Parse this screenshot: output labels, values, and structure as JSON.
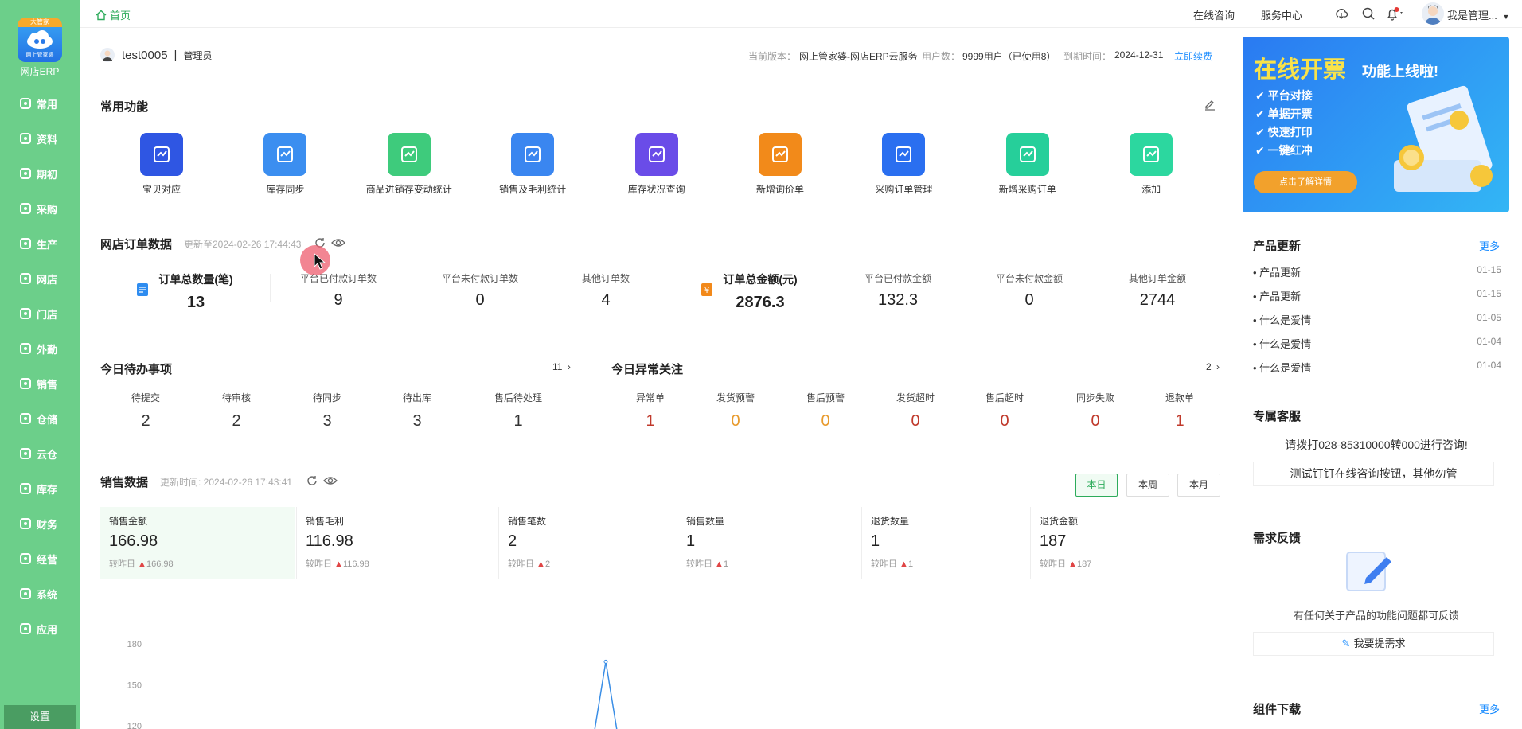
{
  "sidebar": {
    "logo_ribbon": "大管家",
    "logo_sub": "网上管家婆",
    "app_name": "网店ERP",
    "items": [
      {
        "label": "常用",
        "icon": "star-icon"
      },
      {
        "label": "资料",
        "icon": "document-icon"
      },
      {
        "label": "期初",
        "icon": "clock-icon"
      },
      {
        "label": "采购",
        "icon": "cart-icon"
      },
      {
        "label": "生产",
        "icon": "factory-icon"
      },
      {
        "label": "网店",
        "icon": "store-icon"
      },
      {
        "label": "门店",
        "icon": "shop-icon"
      },
      {
        "label": "外勤",
        "icon": "location-icon"
      },
      {
        "label": "销售",
        "icon": "sales-icon"
      },
      {
        "label": "仓储",
        "icon": "warehouse-icon"
      },
      {
        "label": "云仓",
        "icon": "cloud-warehouse-icon"
      },
      {
        "label": "库存",
        "icon": "inventory-icon"
      },
      {
        "label": "财务",
        "icon": "finance-icon"
      },
      {
        "label": "经营",
        "icon": "business-icon"
      },
      {
        "label": "系统",
        "icon": "gear-icon"
      },
      {
        "label": "应用",
        "icon": "plus-square-icon"
      }
    ],
    "settings": "设置"
  },
  "topbar": {
    "home_tab": "首页",
    "online_consult": "在线咨询",
    "service_center": "服务中心",
    "user_name": "我是管理..."
  },
  "user": {
    "name": "test0005",
    "separator": "|",
    "role": "管理员",
    "version_label": "当前版本：",
    "version": "网上管家婆-网店ERP云服务",
    "users_label": "用户数：",
    "users": "9999用户（已使用8）",
    "expire_label": "到期时间：",
    "expire": "2024-12-31",
    "renew": "立即续费"
  },
  "common_functions": {
    "title": "常用功能",
    "items": [
      {
        "label": "宝贝对应",
        "color": "#2f56e3"
      },
      {
        "label": "库存同步",
        "color": "#3b8ef0"
      },
      {
        "label": "商品进销存变动统计",
        "color": "#3ecb7c"
      },
      {
        "label": "销售及毛利统计",
        "color": "#3a86f0"
      },
      {
        "label": "库存状况查询",
        "color": "#6a4ce8"
      },
      {
        "label": "新增询价单",
        "color": "#f28a1a"
      },
      {
        "label": "采购订单管理",
        "color": "#2a6ff0"
      },
      {
        "label": "新增采购订单",
        "color": "#26cf9a"
      },
      {
        "label": "添加",
        "color": "#2cd79f"
      }
    ]
  },
  "order_data": {
    "title": "网店订单数据",
    "updated": "更新至2024-02-26 17:44:43",
    "stats": [
      {
        "label": "订单总数量(笔)",
        "value": "13"
      },
      {
        "label": "平台已付款订单数",
        "value": "9"
      },
      {
        "label": "平台未付款订单数",
        "value": "0"
      },
      {
        "label": "其他订单数",
        "value": "4"
      },
      {
        "label": "订单总金额(元)",
        "value": "2876.3"
      },
      {
        "label": "平台已付款金额",
        "value": "132.3"
      },
      {
        "label": "平台未付款金额",
        "value": "0"
      },
      {
        "label": "其他订单金额",
        "value": "2744"
      }
    ]
  },
  "todo": {
    "title": "今日待办事项",
    "count": "11",
    "items": [
      {
        "label": "待提交",
        "value": "2"
      },
      {
        "label": "待审核",
        "value": "2"
      },
      {
        "label": "待同步",
        "value": "3"
      },
      {
        "label": "待出库",
        "value": "3"
      },
      {
        "label": "售后待处理",
        "value": "1"
      }
    ]
  },
  "abnormal": {
    "title": "今日异常关注",
    "count": "2",
    "items": [
      {
        "label": "异常单",
        "value": "1",
        "color": "#c0392b"
      },
      {
        "label": "发货预警",
        "value": "0",
        "color": "#e89a2c"
      },
      {
        "label": "售后预警",
        "value": "0",
        "color": "#e89a2c"
      },
      {
        "label": "发货超时",
        "value": "0",
        "color": "#c0392b"
      },
      {
        "label": "售后超时",
        "value": "0",
        "color": "#c0392b"
      },
      {
        "label": "同步失败",
        "value": "0",
        "color": "#c0392b"
      },
      {
        "label": "退款单",
        "value": "1",
        "color": "#c0392b"
      }
    ]
  },
  "sales": {
    "title": "销售数据",
    "updated": "更新时间: 2024-02-26 17:43:41",
    "periods": [
      "本日",
      "本周",
      "本月"
    ],
    "compare_label": "较昨日",
    "cards": [
      {
        "label": "销售金额",
        "value": "166.98",
        "delta": "166.98"
      },
      {
        "label": "销售毛利",
        "value": "116.98",
        "delta": "116.98"
      },
      {
        "label": "销售笔数",
        "value": "2",
        "delta": "2"
      },
      {
        "label": "销售数量",
        "value": "1",
        "delta": "1"
      },
      {
        "label": "退货数量",
        "value": "1",
        "delta": "1"
      },
      {
        "label": "退货金额",
        "value": "187",
        "delta": "187"
      }
    ],
    "y_ticks": [
      "180",
      "150",
      "120"
    ]
  },
  "chart_data": {
    "type": "line",
    "yticks": [
      180,
      150,
      120
    ],
    "series": [
      {
        "values": [
          0,
          166.98,
          0
        ]
      }
    ]
  },
  "banner": {
    "title": "在线开票",
    "title2": "功能上线啦!",
    "items": [
      "平台对接",
      "单据开票",
      "快速打印",
      "一键红冲"
    ],
    "button": "点击了解详情"
  },
  "updates": {
    "title": "产品更新",
    "more": "更多",
    "items": [
      {
        "title": "产品更新",
        "date": "01-15"
      },
      {
        "title": "产品更新",
        "date": "01-15"
      },
      {
        "title": "什么是爱情",
        "date": "01-05"
      },
      {
        "title": "什么是爱情",
        "date": "01-04"
      },
      {
        "title": "什么是爱情",
        "date": "01-04"
      }
    ]
  },
  "service": {
    "title": "专属客服",
    "phone_text": "请拨打028-85310000转000进行咨询!",
    "dingtalk_text": "测试钉钉在线咨询按钮，其他勿管"
  },
  "feedback": {
    "title": "需求反馈",
    "desc": "有任何关于产品的功能问题都可反馈",
    "button": "我要提需求"
  },
  "downloads": {
    "title": "组件下载",
    "more": "更多"
  }
}
